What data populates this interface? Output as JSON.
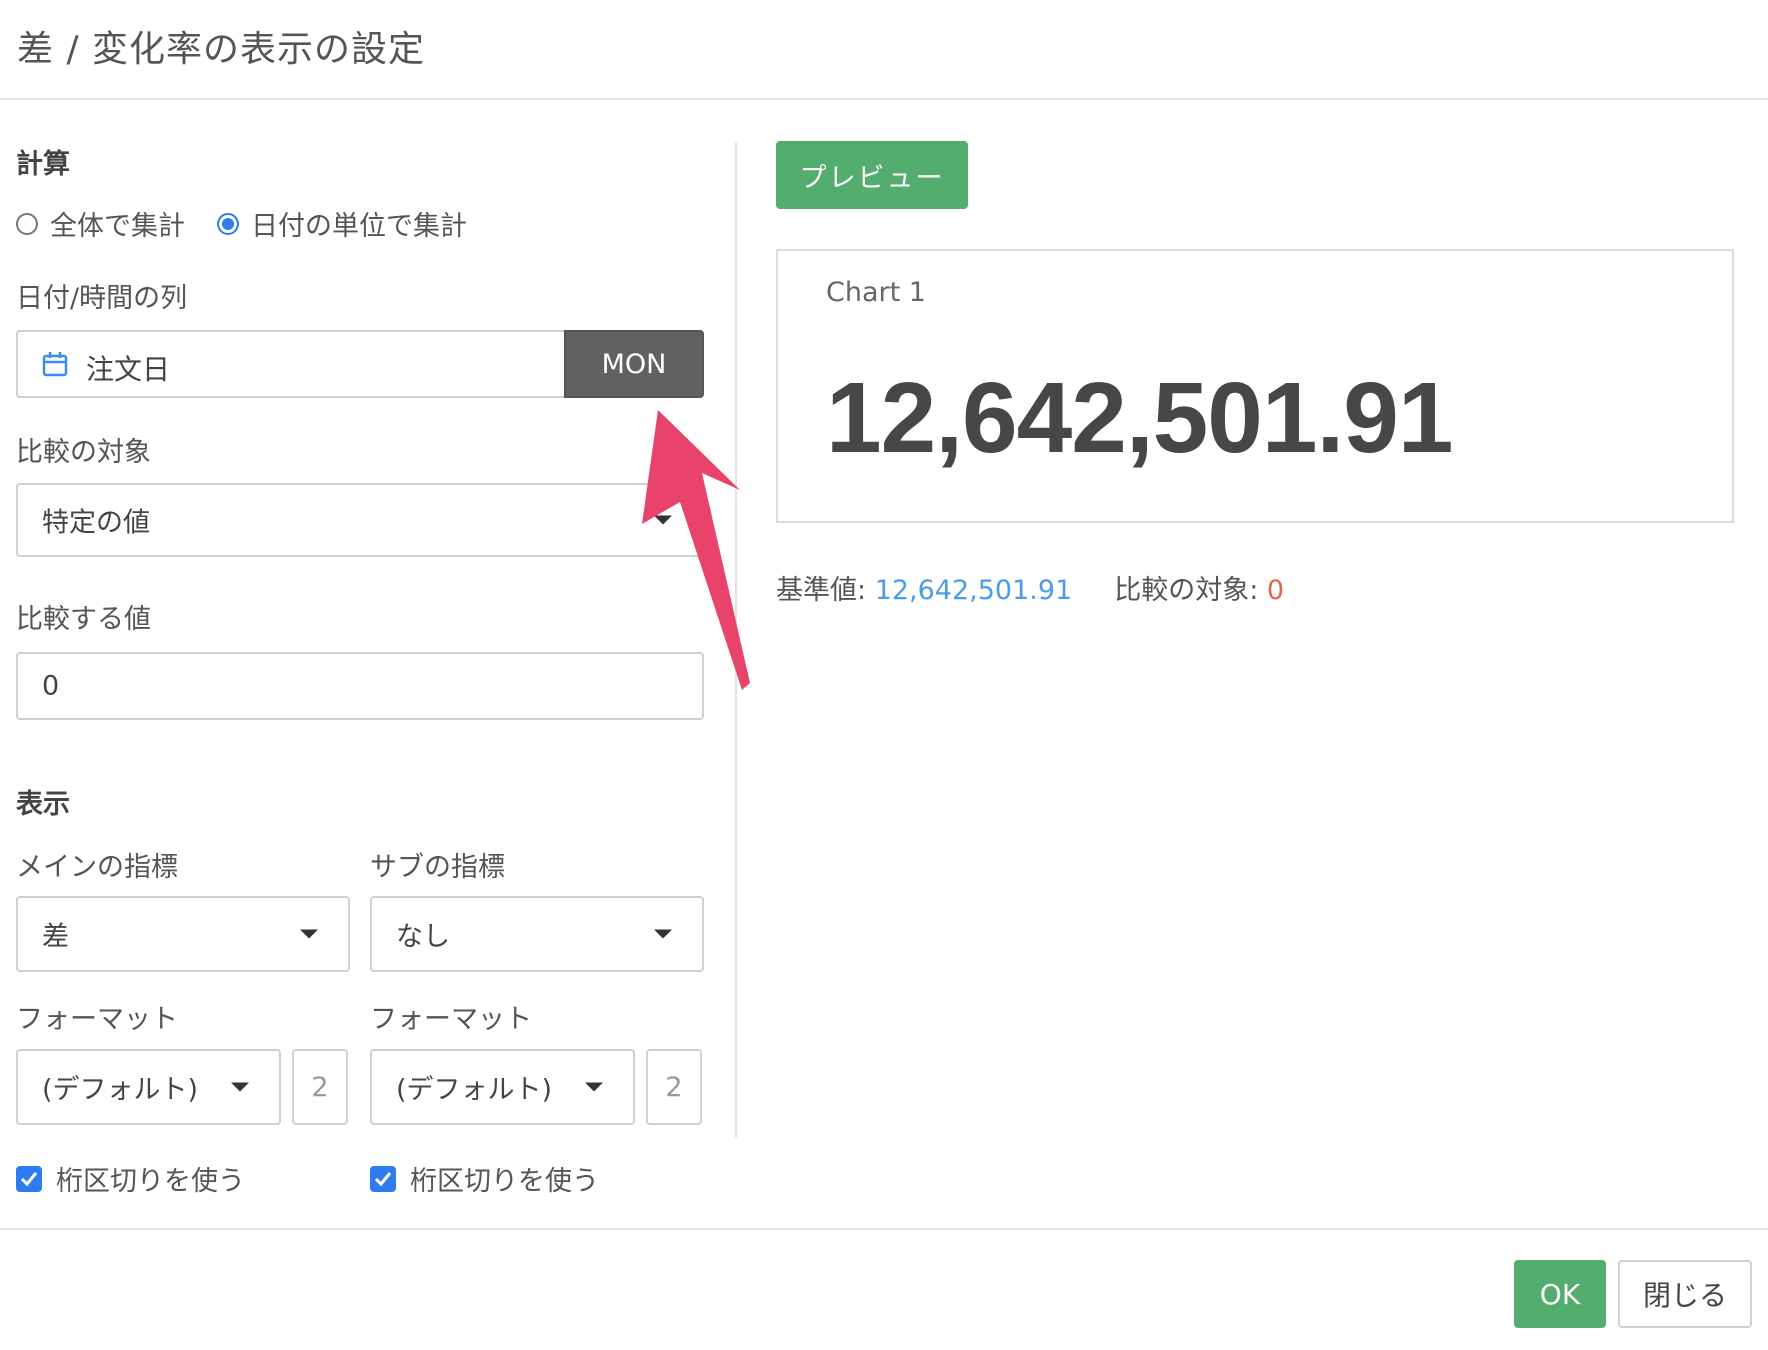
{
  "dialog": {
    "title": "差 / 変化率の表示の設定"
  },
  "calc": {
    "section_title": "計算",
    "radio_options": [
      "全体で集計",
      "日付の単位で集計"
    ],
    "selected_radio": 1,
    "date_column_label": "日付/時間の列",
    "date_column_value": "注文日",
    "date_unit_button": "MON",
    "compare_target_label": "比較の対象",
    "compare_target_value": "特定の値",
    "compare_value_label": "比較する値",
    "compare_value": "0"
  },
  "display": {
    "section_title": "表示",
    "main_metric_label": "メインの指標",
    "main_metric_value": "差",
    "sub_metric_label": "サブの指標",
    "sub_metric_value": "なし",
    "main_format_label": "フォーマット",
    "main_format_value": "(デフォルト)",
    "main_decimals": "2",
    "sub_format_label": "フォーマット",
    "sub_format_value": "(デフォルト)",
    "sub_decimals": "2",
    "main_separator_label": "桁区切りを使う",
    "main_separator_checked": true,
    "sub_separator_label": "桁区切りを使う",
    "sub_separator_checked": true
  },
  "preview": {
    "button_label": "プレビュー",
    "chart_name": "Chart 1",
    "big_value": "12,642,501.91",
    "base_label": "基準値: ",
    "base_value": "12,642,501.91",
    "compare_label": "比較の対象: ",
    "compare_value": "0"
  },
  "footer": {
    "ok_label": "OK",
    "close_label": "閉じる"
  },
  "colors": {
    "accent_green": "#52ad6f",
    "accent_blue": "#2f7bf0",
    "arrow_pink": "#e8436b",
    "unit_button": "#616161"
  }
}
